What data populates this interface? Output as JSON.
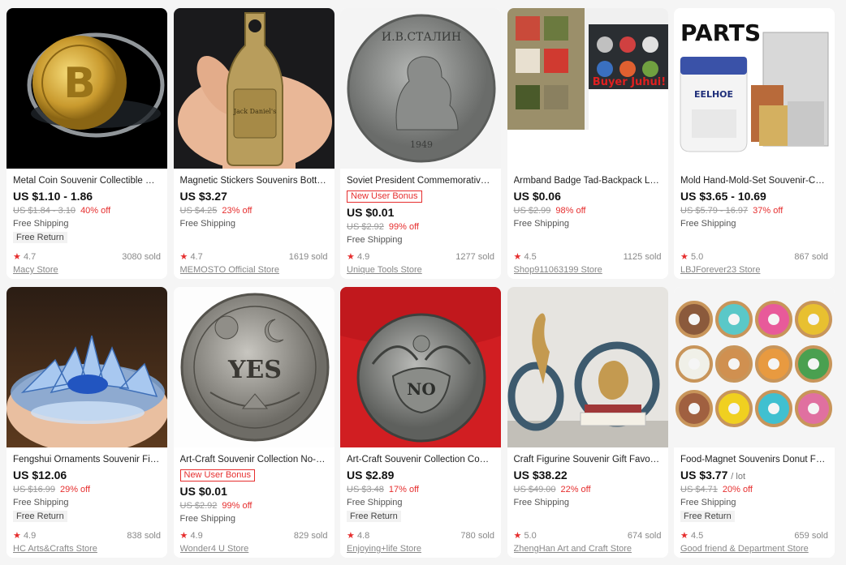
{
  "products": [
    {
      "title": "Metal Coin Souvenir Collectible Co...",
      "badge": "",
      "price": "US $1.10 - 1.86",
      "unit": "",
      "orig": "US $1.84 - 3.10",
      "discount": "40% off",
      "shipping": "Free Shipping",
      "return": "Free Return",
      "rating": "4.7",
      "sold": "3080 sold",
      "store": "Macy Store",
      "image": "bitcoin-coin"
    },
    {
      "title": "Magnetic Stickers Souvenirs Bottle...",
      "badge": "",
      "price": "US $3.27",
      "unit": "",
      "orig": "US $4.25",
      "discount": "23% off",
      "shipping": "Free Shipping",
      "return": "",
      "rating": "4.7",
      "sold": "1619 sold",
      "store": "MEMOSTO Official Store",
      "image": "bottle-opener"
    },
    {
      "title": "Soviet President Commemorative ...",
      "badge": "New User Bonus",
      "price": "US $0.01",
      "unit": "",
      "orig": "US $2.92",
      "discount": "99% off",
      "shipping": "Free Shipping",
      "return": "",
      "rating": "4.9",
      "sold": "1277 sold",
      "store": "Unique Tools Store",
      "image": "stalin-coin"
    },
    {
      "title": "Armband Badge Tad-Backpack Log...",
      "badge": "",
      "price": "US $0.06",
      "unit": "",
      "orig": "US $2.99",
      "discount": "98% off",
      "shipping": "Free Shipping",
      "return": "",
      "rating": "4.5",
      "sold": "1125 sold",
      "store": "Shop911063199 Store",
      "image": "patches"
    },
    {
      "title": "Mold Hand-Mold-Set Souvenir-Cas...",
      "badge": "",
      "price": "US $3.65 - 10.69",
      "unit": "",
      "orig": "US $5.79 - 16.97",
      "discount": "37% off",
      "shipping": "Free Shipping",
      "return": "",
      "rating": "5.0",
      "sold": "867 sold",
      "store": "LBJForever23 Store",
      "image": "mold-kit"
    },
    {
      "title": "Fengshui Ornaments Souvenir Fig...",
      "badge": "",
      "price": "US $12.06",
      "unit": "",
      "orig": "US $16.99",
      "discount": "29% off",
      "shipping": "Free Shipping",
      "return": "Free Return",
      "rating": "4.9",
      "sold": "838 sold",
      "store": "HC Arts&Crafts Store",
      "image": "crystal-lotus"
    },
    {
      "title": "Art-Craft Souvenir Collection No-C...",
      "badge": "New User Bonus",
      "price": "US $0.01",
      "unit": "",
      "orig": "US $2.92",
      "discount": "99% off",
      "shipping": "Free Shipping",
      "return": "",
      "rating": "4.9",
      "sold": "829 sold",
      "store": "Wonder4 U Store",
      "image": "yes-coin"
    },
    {
      "title": "Art-Craft Souvenir Collection Com...",
      "badge": "",
      "price": "US $2.89",
      "unit": "",
      "orig": "US $3.48",
      "discount": "17% off",
      "shipping": "Free Shipping",
      "return": "Free Return",
      "rating": "4.8",
      "sold": "780 sold",
      "store": "Enjoying+life Store",
      "image": "no-coin"
    },
    {
      "title": "Craft Figurine Souvenir Gift Favour...",
      "badge": "",
      "price": "US $38.22",
      "unit": "",
      "orig": "US $49.00",
      "discount": "22% off",
      "shipping": "Free Shipping",
      "return": "",
      "rating": "5.0",
      "sold": "674 sold",
      "store": "ZhengHan Art and Craft Store",
      "image": "figurine"
    },
    {
      "title": "Food-Magnet Souvenirs Donut Fri...",
      "badge": "",
      "price": "US $3.77",
      "unit": "/ lot",
      "orig": "US $4.71",
      "discount": "20% off",
      "shipping": "Free Shipping",
      "return": "Free Return",
      "rating": "4.5",
      "sold": "659 sold",
      "store": "Good friend & Department Store",
      "image": "donuts"
    }
  ],
  "image_text": {
    "parts": "PARTS",
    "eelhoe": "EELHOE",
    "buyer": "Buyer Juhui!",
    "coin_ru": "И.В.СТАЛИН",
    "coin_year": "1949",
    "yes": "YES",
    "no": "NO",
    "bottle": "Jack Daniel's"
  }
}
